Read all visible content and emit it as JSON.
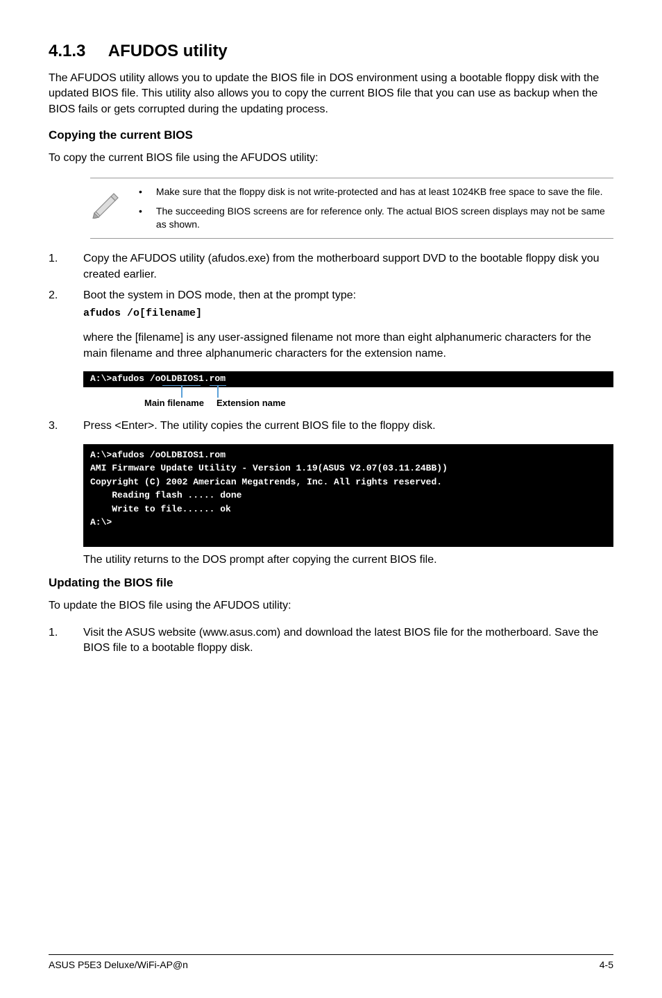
{
  "section": {
    "number": "4.1.3",
    "title": "AFUDOS utility"
  },
  "intro": "The AFUDOS utility allows you to update the BIOS file in DOS environment using a bootable floppy disk with the updated BIOS file. This utility also allows you to copy the current BIOS file that you can use as backup when the BIOS fails or gets corrupted during the updating process.",
  "copying": {
    "heading": "Copying the current BIOS",
    "lead": "To copy the current BIOS file using the AFUDOS utility:",
    "notes": [
      "Make sure that the floppy disk is not write-protected and has at least 1024KB free space to save the file.",
      "The succeeding BIOS screens are for reference only. The actual BIOS screen displays may not be same as shown."
    ],
    "steps": {
      "s1": {
        "num": "1.",
        "text": "Copy the AFUDOS utility (afudos.exe) from the motherboard support DVD to the bootable floppy disk you created earlier."
      },
      "s2": {
        "num": "2.",
        "text": "Boot the system in DOS mode, then at the prompt type:",
        "code": "afudos /o[filename]",
        "after": "where the [filename] is any user-assigned filename not more than eight alphanumeric characters  for the main filename and three alphanumeric characters for the extension name."
      },
      "s3": {
        "num": "3.",
        "text": "Press <Enter>. The utility copies the current BIOS file to the floppy disk."
      }
    },
    "callout_cmd": "A:\\>afudos /oOLDBIOS1.rom",
    "callout_labels": {
      "main": "Main filename",
      "ext": "Extension name"
    },
    "terminal_output": "A:\\>afudos /oOLDBIOS1.rom\nAMI Firmware Update Utility - Version 1.19(ASUS V2.07(03.11.24BB))\nCopyright (C) 2002 American Megatrends, Inc. All rights reserved.\n    Reading flash ..... done\n    Write to file...... ok\nA:\\>\n ",
    "return_text": "The utility returns to the DOS prompt after copying the current BIOS file."
  },
  "updating": {
    "heading": "Updating the BIOS file",
    "lead": "To update the BIOS file using the AFUDOS utility:",
    "steps": {
      "s1": {
        "num": "1.",
        "text": "Visit the ASUS website (www.asus.com) and download the latest BIOS file for the motherboard. Save the BIOS file to a bootable floppy disk."
      }
    }
  },
  "footer": {
    "left": "ASUS P5E3 Deluxe/WiFi-AP@n",
    "right": "4-5"
  }
}
